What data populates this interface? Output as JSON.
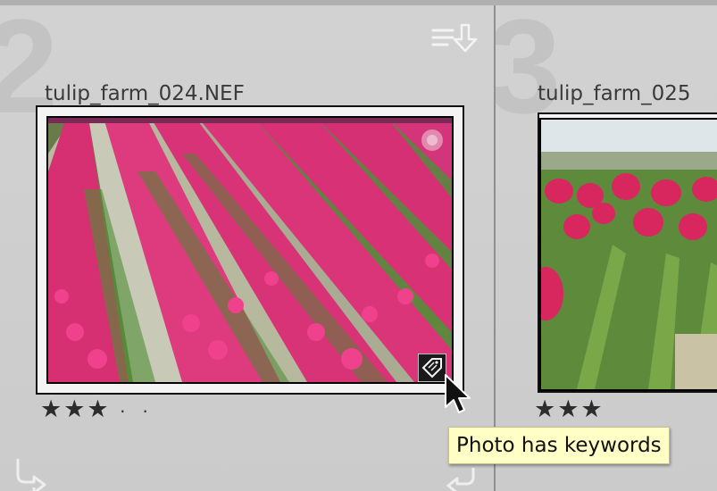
{
  "cells": [
    {
      "index": "2",
      "filename": "tulip_farm_024.NEF",
      "rating_stars": "★★★",
      "rating_value": 3,
      "rating_empty": [
        "·",
        "·"
      ]
    },
    {
      "index": "3",
      "filename": "tulip_farm_025",
      "rating_stars": "★★★",
      "rating_value": 3
    }
  ],
  "icons": {
    "sort": "sort-lines-arrow-icon",
    "keyword_badge": "keyword-tag-icon",
    "rotate_left": "rotate-left-arrow-icon",
    "rotate_right": "rotate-right-arrow-icon",
    "cursor": "mouse-pointer-icon"
  },
  "tooltip": {
    "text": "Photo has keywords"
  },
  "colors": {
    "background": "#c9c9c9",
    "tooltip_background": "#ffffc6",
    "frame_border": "#111111",
    "tulip_pink": "#e0307a"
  }
}
